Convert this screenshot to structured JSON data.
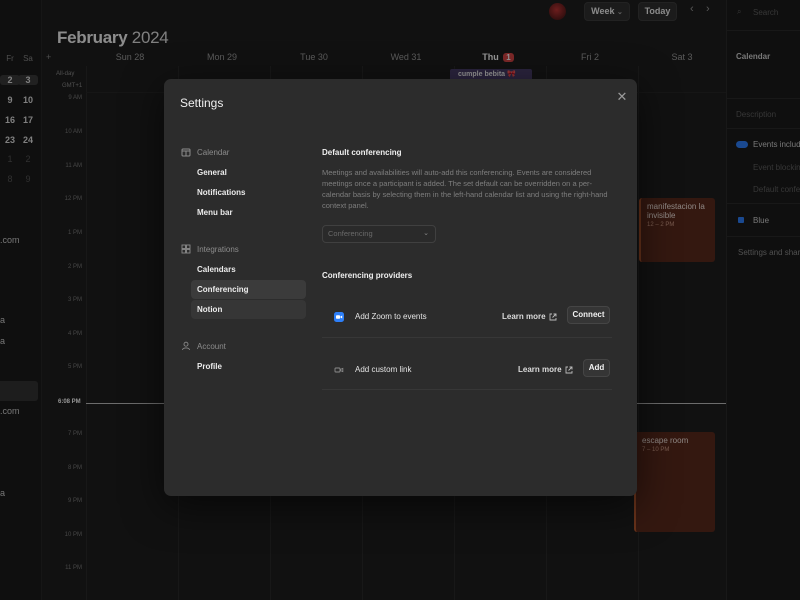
{
  "calendar": {
    "month": "February",
    "year": "2024",
    "days": [
      {
        "label": "Sun 28"
      },
      {
        "label": "Mon 29"
      },
      {
        "label": "Tue 30"
      },
      {
        "label": "Wed 31"
      },
      {
        "label": "Thu"
      },
      {
        "label": "Fri 2"
      },
      {
        "label": "Sat 3"
      }
    ],
    "today_badge": "1",
    "allday_label": "All-day",
    "tz_label": "GMT+1",
    "hours": [
      "9 AM",
      "10 AM",
      "11 AM",
      "12 PM",
      "1 PM",
      "2 PM",
      "3 PM",
      "4 PM",
      "5 PM",
      "7 PM",
      "8 PM",
      "9 PM",
      "10 PM",
      "11 PM"
    ],
    "now_label": "6:08 PM",
    "add_button": "+",
    "view_button": "Week",
    "today_button": "Today",
    "events": {
      "cumple": {
        "title": "cumple bebita 🎀"
      },
      "manifestacion": {
        "title": "manifestacion la invisible",
        "time": "12 – 2 PM"
      },
      "escape": {
        "title": "escape room",
        "time": "7 – 10 PM"
      }
    }
  },
  "mini_calendar": {
    "dow": [
      "Fr",
      "Sa"
    ],
    "rows": [
      [
        "2",
        "3"
      ],
      [
        "9",
        "10"
      ],
      [
        "16",
        "17"
      ],
      [
        "23",
        "24"
      ],
      [
        "1",
        "2"
      ],
      [
        "8",
        "9"
      ]
    ],
    "left_fragments": [
      ".com",
      "a",
      "a",
      ".com",
      "a"
    ]
  },
  "right_panel": {
    "search_placeholder": "Search",
    "calendar_label": "Calendar",
    "description_label": "Description",
    "events_included": "Events included",
    "event_blocking": "Event blocking",
    "default_conferencing": "Default conferencing",
    "color_label": "Blue",
    "settings_sharing": "Settings and sharing"
  },
  "settings": {
    "title": "Settings",
    "close_icon": "close-icon",
    "nav": {
      "calendar_section": "Calendar",
      "calendar_items": [
        "General",
        "Notifications",
        "Menu bar"
      ],
      "integrations_section": "Integrations",
      "integrations_items": [
        "Calendars",
        "Conferencing",
        "Notion"
      ],
      "account_section": "Account",
      "account_items": [
        "Profile"
      ]
    },
    "default_conferencing": {
      "title": "Default conferencing",
      "description": "Meetings and availabilities will auto-add this conferencing. Events are considered meetings once a participant is added. The set default can be overridden on a per-calendar basis by selecting them in the left-hand calendar list and using the right-hand context panel.",
      "select_placeholder": "Conferencing"
    },
    "providers": {
      "title": "Conferencing providers",
      "zoom": {
        "label": "Add Zoom to events",
        "learn_more": "Learn more",
        "button": "Connect"
      },
      "custom": {
        "label": "Add custom link",
        "learn_more": "Learn more",
        "button": "Add"
      }
    }
  },
  "colors": {
    "accent_blue": "#2d7ff9",
    "today_red": "#d64545",
    "event_brown": "#5b2a1c",
    "event_purple": "#4b3f6b"
  }
}
